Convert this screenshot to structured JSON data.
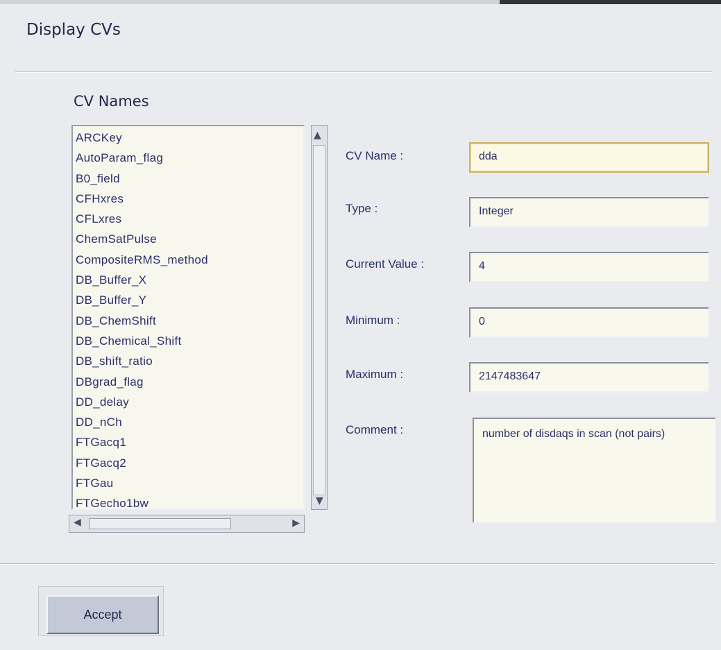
{
  "dialog": {
    "title": "Display CVs"
  },
  "cv_list": {
    "label": "CV Names",
    "items": [
      "ARCKey",
      "AutoParam_flag",
      "B0_field",
      "CFHxres",
      "CFLxres",
      "ChemSatPulse",
      "CompositeRMS_method",
      "DB_Buffer_X",
      "DB_Buffer_Y",
      "DB_ChemShift",
      "DB_Chemical_Shift",
      "DB_shift_ratio",
      "DBgrad_flag",
      "DD_delay",
      "DD_nCh",
      "FTGacq1",
      "FTGacq2",
      "FTGau",
      "FTGecho1bw"
    ]
  },
  "form": {
    "cv_name": {
      "label": "CV Name :",
      "value": "dda"
    },
    "type": {
      "label": "Type :",
      "value": "Integer"
    },
    "current_value": {
      "label": "Current Value :",
      "value": "4"
    },
    "minimum": {
      "label": "Minimum :",
      "value": "0"
    },
    "maximum": {
      "label": "Maximum :",
      "value": "2147483647"
    },
    "comment": {
      "label": "Comment :",
      "value": "number of disdaqs in scan (not pairs)"
    }
  },
  "actions": {
    "accept_label": "Accept"
  },
  "icons": {
    "scroll_up": "arrow-up-icon",
    "scroll_down": "arrow-down-icon",
    "scroll_left": "arrow-left-icon",
    "scroll_right": "arrow-right-icon"
  },
  "colors": {
    "background": "#e9ebee",
    "field_background": "#f8f8ec",
    "focus_border": "#c9b56a",
    "text": "#2a2f6a"
  }
}
